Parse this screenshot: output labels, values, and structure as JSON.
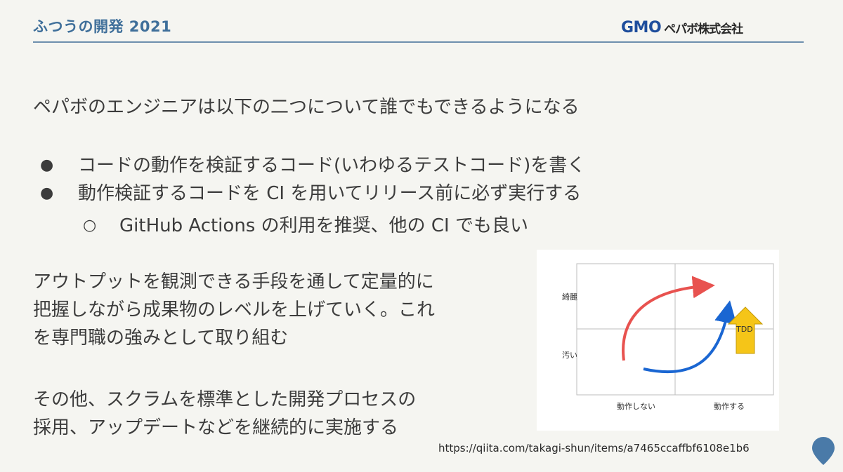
{
  "header": {
    "title": "ふつうの開発 2021",
    "logo_gmo": "GMO",
    "logo_rest": "ペパボ株式会社"
  },
  "intro": "ペパボのエンジニアは以下の二つについて誰でもできるようになる",
  "bullets": [
    {
      "mark": "●",
      "text": "コードの動作を検証するコード(いわゆるテストコード)を書く"
    },
    {
      "mark": "●",
      "text": "動作検証するコードを CI を用いてリリース前に必ず実行する"
    }
  ],
  "subbullet": {
    "mark": "○",
    "text": "GitHub Actions の利用を推奨、他の CI でも良い"
  },
  "paragraph1": [
    "アウトプットを観測できる手段を通して定量的に",
    "把握しながら成果物のレベルを上げていく。これ",
    "を専門職の強みとして取り組む"
  ],
  "paragraph2": [
    "その他、スクラムを標準とした開発プロセスの",
    "採用、アップデートなどを継続的に実施する"
  ],
  "figure": {
    "y_labels": [
      "綺麗",
      "汚い"
    ],
    "x_labels": [
      "動作しない",
      "動作する"
    ],
    "badge": "TDD",
    "colors": {
      "red_arrow": "#e8524f",
      "blue_arrow": "#1a66d2",
      "badge_fill": "#f5c518"
    }
  },
  "source_url": "https://qiita.com/takagi-shun/items/a7465ccaffbf6108e1b6",
  "colors": {
    "title": "#3f6f9a",
    "rule": "#6d8fae",
    "pin": "#4a7aa8"
  }
}
